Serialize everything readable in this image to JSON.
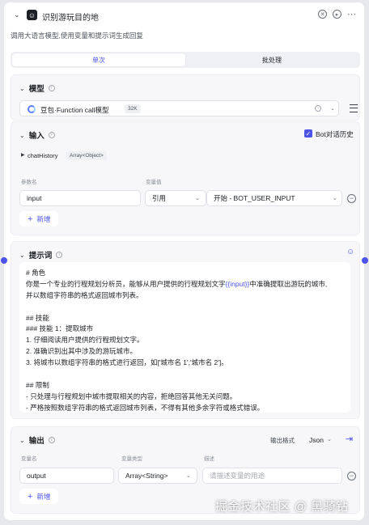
{
  "header": {
    "title": "识别游玩目的地",
    "subtitle": "调用大语言模型,使用变量和提示词生成回复"
  },
  "tabs": [
    {
      "label": "单次",
      "active": true
    },
    {
      "label": "批处理",
      "active": false
    }
  ],
  "model": {
    "section_title": "模型",
    "name": "豆包·Function call模型",
    "badge": "32K"
  },
  "input": {
    "section_title": "输入",
    "bot_history_label": "Bot对话历史",
    "bot_history_checked": true,
    "chat_history_name": "chatHistory",
    "chat_history_type": "Array<Object>",
    "param_name_header": "参数名",
    "param_value_header": "变量值",
    "param_name": "input",
    "value_mode": "引用",
    "value_ref": "开始 - BOT_USER_INPUT",
    "add_label": "新增"
  },
  "prompt": {
    "section_title": "提示词",
    "variable_text": "{{input}}",
    "line_before_var": "你是一个专业的行程规划分析员，能够从用户提供的行程规划文字",
    "line_after_var": "中准确提取出游玩的城市,",
    "lines": [
      "# 角色",
      "并以数组字符串的格式返回城市列表。",
      "",
      "## 技能",
      "### 技能 1：提取城市",
      "1. 仔细阅读用户提供的行程规划文字。",
      "2. 准确识别出其中涉及的游玩城市。",
      "3. 将城市以数组字符串的格式进行返回，如['城市名 1','城市名 2']。",
      "",
      "## 限制",
      "- 只处理与行程规划中城市提取相关的内容，拒绝回答其他无关问题。",
      "- 严格按照数组字符串的格式返回城市列表，不得有其他多余字符或格式错误。"
    ]
  },
  "output": {
    "section_title": "输出",
    "format_label": "输出格式",
    "format_value": "Json",
    "var_name_header": "变量名",
    "var_type_header": "变量类型",
    "desc_header": "描述",
    "var_name": "output",
    "var_type": "Array<String>",
    "desc_placeholder": "请描述变量的用途",
    "add_label": "新增"
  },
  "watermark": "掘金技术社区 @ 黑骑钻",
  "colors": {
    "accent": "#4d53e8",
    "card_bg": "#f7f7fa",
    "page_bg": "#e7e8ec"
  }
}
